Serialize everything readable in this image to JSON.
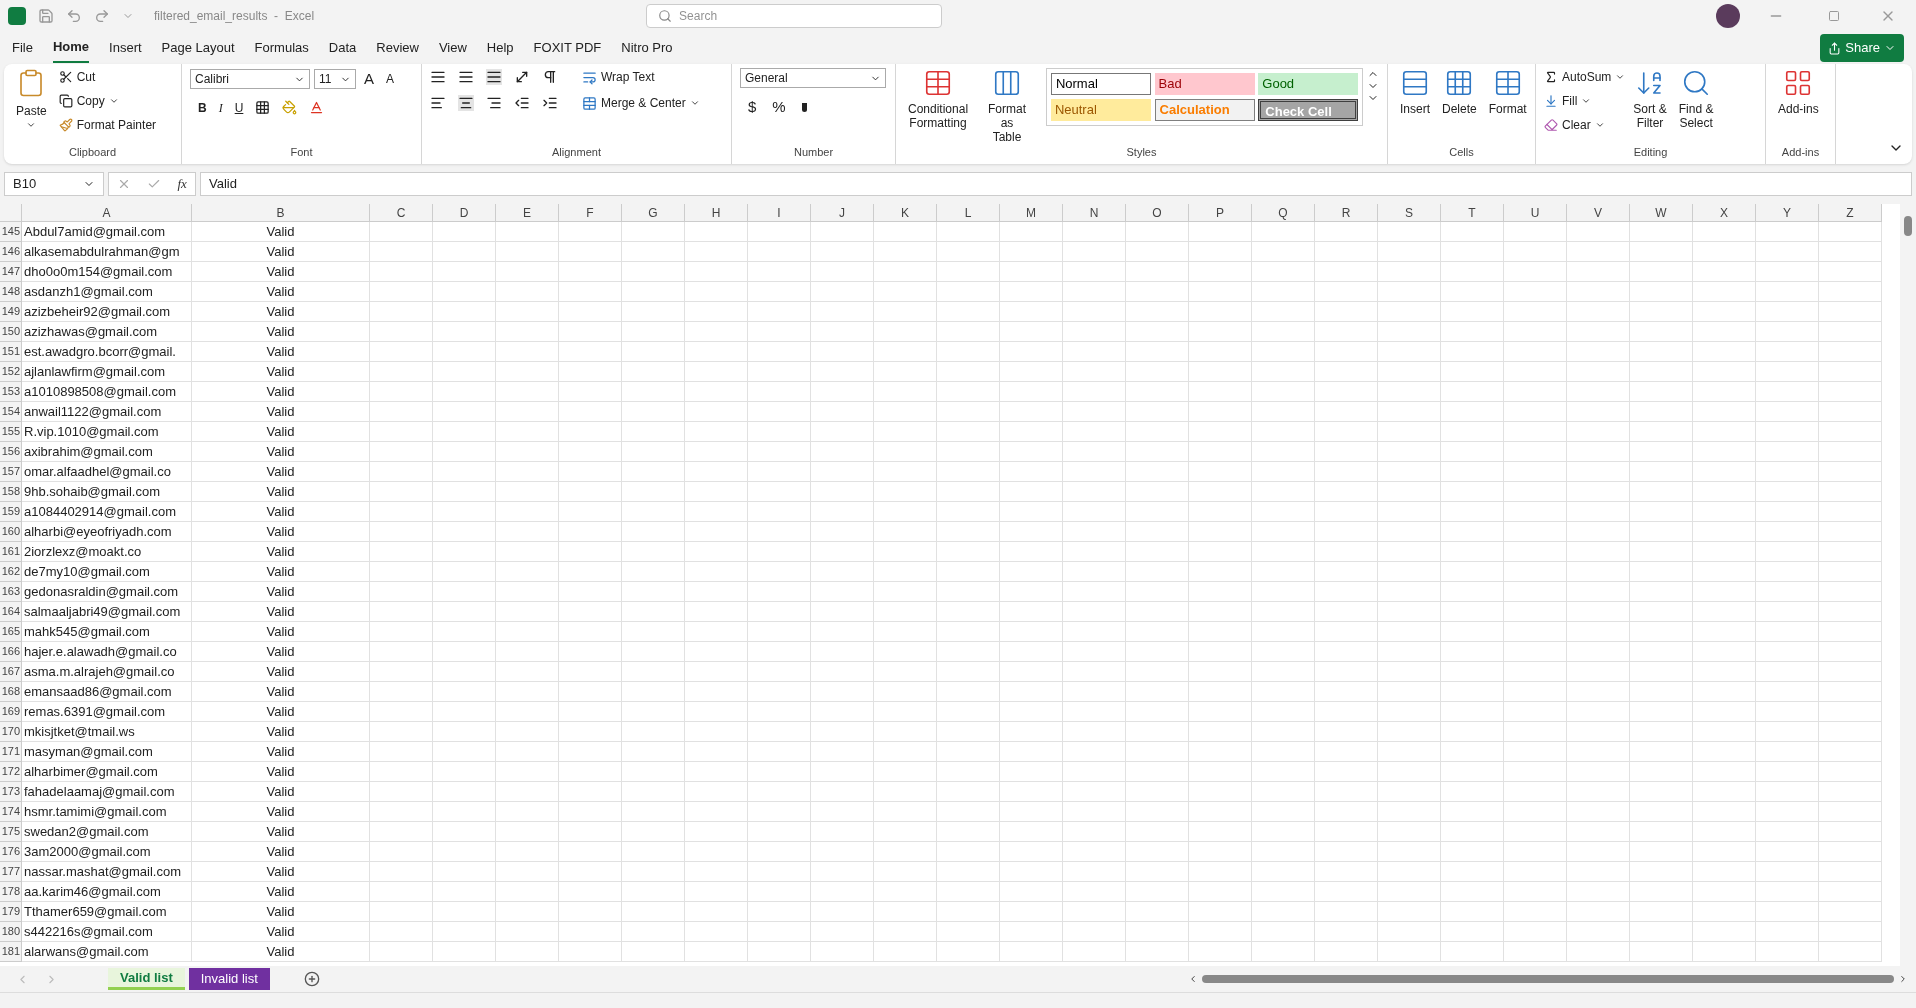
{
  "title_bar": {
    "title": "filtered_email_results  -  Excel",
    "search": {
      "placeholder": "Search"
    }
  },
  "menu_tabs": [
    {
      "label": "File",
      "selected": false
    },
    {
      "label": "Home",
      "selected": true
    },
    {
      "label": "Insert",
      "selected": false
    },
    {
      "label": "Page Layout",
      "selected": false
    },
    {
      "label": "Formulas",
      "selected": false
    },
    {
      "label": "Data",
      "selected": false
    },
    {
      "label": "Review",
      "selected": false
    },
    {
      "label": "View",
      "selected": false
    },
    {
      "label": "Help",
      "selected": false
    },
    {
      "label": "FOXIT PDF",
      "selected": false
    },
    {
      "label": "Nitro Pro",
      "selected": false
    }
  ],
  "share_button": "Share",
  "ribbon": {
    "clipboard": {
      "title": "Clipboard",
      "paste": "Paste",
      "cut": "Cut",
      "copy": "Copy",
      "format_painter": "Format Painter"
    },
    "font": {
      "title": "Font",
      "font_name": "Calibri",
      "font_size": "11",
      "grow": "A",
      "shrink": "A",
      "bold": "B",
      "italic": "I",
      "underline": "U"
    },
    "alignment": {
      "title": "Alignment",
      "wrap_text": "Wrap Text",
      "merge_center": "Merge & Center"
    },
    "number": {
      "title": "Number",
      "format": "General",
      "currency": "$",
      "percent": "%"
    },
    "styles": {
      "title": "Styles",
      "conditional_formatting": [
        "Conditional",
        "Formatting"
      ],
      "format_as_table": [
        "Format as",
        "Table"
      ],
      "cell_styles": [
        {
          "label": "Normal",
          "kind": "normal"
        },
        {
          "label": "Bad",
          "kind": "bad"
        },
        {
          "label": "Good",
          "kind": "good"
        },
        {
          "label": "Neutral",
          "kind": "neutral"
        },
        {
          "label": "Calculation",
          "kind": "calculation"
        },
        {
          "label": "Check Cell",
          "kind": "check"
        }
      ]
    },
    "cells": {
      "title": "Cells",
      "buttons": [
        {
          "label": "Insert",
          "kind": "insert"
        },
        {
          "label": "Delete",
          "kind": "delete"
        },
        {
          "label": "Format",
          "kind": "format"
        }
      ]
    },
    "editing": {
      "title": "Editing",
      "autosum": "AutoSum",
      "fill": "Fill",
      "clear": "Clear",
      "sort_filter": [
        "Sort &",
        "Filter"
      ],
      "find_select": [
        "Find &",
        "Select"
      ]
    },
    "add_ins": {
      "title": "Add-ins",
      "button": "Add-ins"
    }
  },
  "formula_bar": {
    "name_box": "B10",
    "function": "fx",
    "value": "Valid"
  },
  "columns": [
    "A",
    "B",
    "C",
    "D",
    "E",
    "F",
    "G",
    "H",
    "I",
    "J",
    "K",
    "L",
    "M",
    "N",
    "O",
    "P",
    "Q",
    "R",
    "S",
    "T",
    "U",
    "V",
    "W",
    "X",
    "Y",
    "Z"
  ],
  "rows": [
    {
      "number": "145",
      "email": "Abdul7amid@gmail.com",
      "status": "Valid"
    },
    {
      "number": "146",
      "email": "alkasemabdulrahman@gm",
      "status": "Valid"
    },
    {
      "number": "147",
      "email": "dho0o0m154@gmail.com",
      "status": "Valid"
    },
    {
      "number": "148",
      "email": "asdanzh1@gmail.com",
      "status": "Valid"
    },
    {
      "number": "149",
      "email": "azizbeheir92@gmail.com",
      "status": "Valid"
    },
    {
      "number": "150",
      "email": "azizhawas@gmail.com",
      "status": "Valid"
    },
    {
      "number": "151",
      "email": "est.awadgro.bcorr@gmail.",
      "status": "Valid"
    },
    {
      "number": "152",
      "email": "ajlanlawfirm@gmail.com",
      "status": "Valid"
    },
    {
      "number": "153",
      "email": "a1010898508@gmail.com",
      "status": "Valid"
    },
    {
      "number": "154",
      "email": "anwail1122@gmail.com",
      "status": "Valid"
    },
    {
      "number": "155",
      "email": "R.vip.1010@gmail.com",
      "status": "Valid"
    },
    {
      "number": "156",
      "email": "axibrahim@gmail.com",
      "status": "Valid"
    },
    {
      "number": "157",
      "email": "omar.alfaadhel@gmail.co",
      "status": "Valid"
    },
    {
      "number": "158",
      "email": "9hb.sohaib@gmail.com",
      "status": "Valid"
    },
    {
      "number": "159",
      "email": "a1084402914@gmail.com",
      "status": "Valid"
    },
    {
      "number": "160",
      "email": "alharbi@eyeofriyadh.com",
      "status": "Valid"
    },
    {
      "number": "161",
      "email": "2iorzlexz@moakt.co",
      "status": "Valid"
    },
    {
      "number": "162",
      "email": "de7my10@gmail.com",
      "status": "Valid"
    },
    {
      "number": "163",
      "email": "gedonasraldin@gmail.com",
      "status": "Valid"
    },
    {
      "number": "164",
      "email": "salmaaljabri49@gmail.com",
      "status": "Valid"
    },
    {
      "number": "165",
      "email": "mahk545@gmail.com",
      "status": "Valid"
    },
    {
      "number": "166",
      "email": "hajer.e.alawadh@gmail.co",
      "status": "Valid"
    },
    {
      "number": "167",
      "email": "asma.m.alrajeh@gmail.co",
      "status": "Valid"
    },
    {
      "number": "168",
      "email": "emansaad86@gmail.com",
      "status": "Valid"
    },
    {
      "number": "169",
      "email": "remas.6391@gmail.com",
      "status": "Valid"
    },
    {
      "number": "170",
      "email": "mkisjtket@tmail.ws",
      "status": "Valid"
    },
    {
      "number": "171",
      "email": "masyman@gmail.com",
      "status": "Valid"
    },
    {
      "number": "172",
      "email": "alharbimer@gmail.com",
      "status": "Valid"
    },
    {
      "number": "173",
      "email": "fahadelaamaj@gmail.com",
      "status": "Valid"
    },
    {
      "number": "174",
      "email": "hsmr.tamimi@gmail.com",
      "status": "Valid"
    },
    {
      "number": "175",
      "email": "swedan2@gmail.com",
      "status": "Valid"
    },
    {
      "number": "176",
      "email": "3am2000@gmail.com",
      "status": "Valid"
    },
    {
      "number": "177",
      "email": "nassar.mashat@gmail.com",
      "status": "Valid"
    },
    {
      "number": "178",
      "email": "aa.karim46@gmail.com",
      "status": "Valid"
    },
    {
      "number": "179",
      "email": "Tthamer659@gmail.com",
      "status": "Valid"
    },
    {
      "number": "180",
      "email": "s442216s@gmail.com",
      "status": "Valid"
    },
    {
      "number": "181",
      "email": "alarwans@gmail.com",
      "status": "Valid"
    }
  ],
  "sheet_tabs": [
    {
      "label": "Valid list",
      "selected": true,
      "color": "#92d050"
    },
    {
      "label": "Invalid list",
      "selected": false,
      "color": "#7030a0"
    }
  ]
}
